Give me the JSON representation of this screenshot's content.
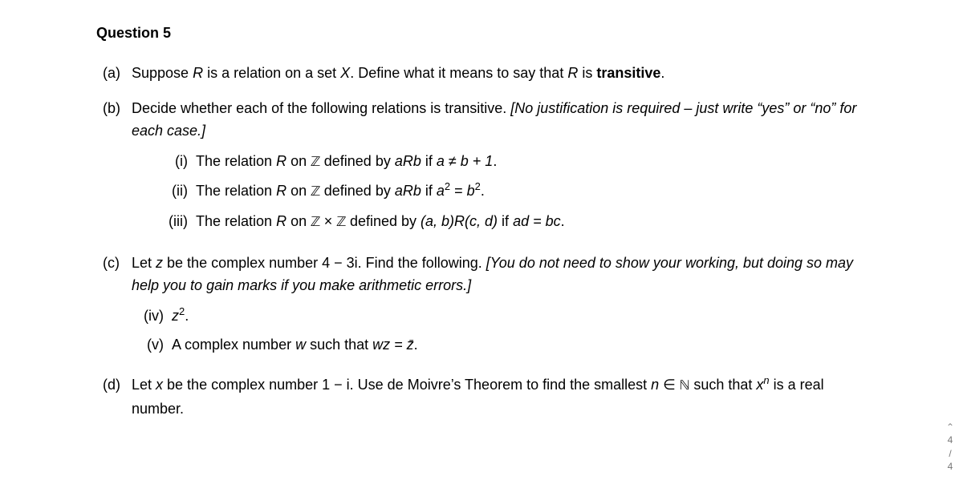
{
  "heading": "Question 5",
  "a": {
    "label": "(a)",
    "text_pre": "Suppose ",
    "R": "R",
    "text_mid1": " is a relation on a set ",
    "X": "X",
    "text_mid2": ". Define what it means to say that ",
    "R2": "R",
    "text_mid3": " is ",
    "bold_word": "transitive",
    "text_end": "."
  },
  "b": {
    "label": "(b)",
    "intro": "Decide whether each of the following relations is transitive. ",
    "note": "[No justification is required – just write “yes” or “no” for each case.]",
    "i": {
      "label": "(i)",
      "pre": "The relation ",
      "R": "R",
      "on": " on ",
      "Z": "ℤ",
      "def": " defined by ",
      "aRb": "aRb",
      "iff": " if ",
      "cond": "a ≠ b + 1",
      "end": "."
    },
    "ii": {
      "label": "(ii)",
      "pre": "The relation ",
      "R": "R",
      "on": " on ",
      "Z": "ℤ",
      "def": " defined by ",
      "aRb": "aRb",
      "iff": " if ",
      "a": "a",
      "sq1": "2",
      "eq": " = ",
      "b": "b",
      "sq2": "2",
      "end": "."
    },
    "iii": {
      "label": "(iii)",
      "pre": "The relation ",
      "R": "R",
      "on": " on ",
      "Z1": "ℤ",
      "times": " × ",
      "Z2": "ℤ",
      "def": " defined by ",
      "rel": "(a, b)R(c, d)",
      "iff": " if ",
      "cond": "ad = bc",
      "end": "."
    }
  },
  "c": {
    "label": "(c)",
    "pre": "Let ",
    "z": "z",
    "mid1": " be the complex number 4 − 3i. Find the following. ",
    "note": "[You do not need to show your working, but doing so may help you to gain marks if you make arithmetic errors.]",
    "iv": {
      "label": "(iv)",
      "z": "z",
      "sq": "2",
      "end": "."
    },
    "v": {
      "label": "(v)",
      "pre": "A complex number ",
      "w": "w",
      "mid": " such that ",
      "eq": "wz = z̄",
      "end": "."
    }
  },
  "d": {
    "label": "(d)",
    "pre": "Let ",
    "x": "x",
    "mid1": " be the complex number 1 − i. Use de Moivre’s Theorem to find the smallest ",
    "n": "n",
    "in": " ∈ ",
    "N": "ℕ",
    "mid2": " such that ",
    "x2": "x",
    "supn": "n",
    "mid3": " is a real number."
  },
  "scrollbar": {
    "up": "⌃",
    "num": "4",
    "sep": "/",
    "den": "4"
  }
}
